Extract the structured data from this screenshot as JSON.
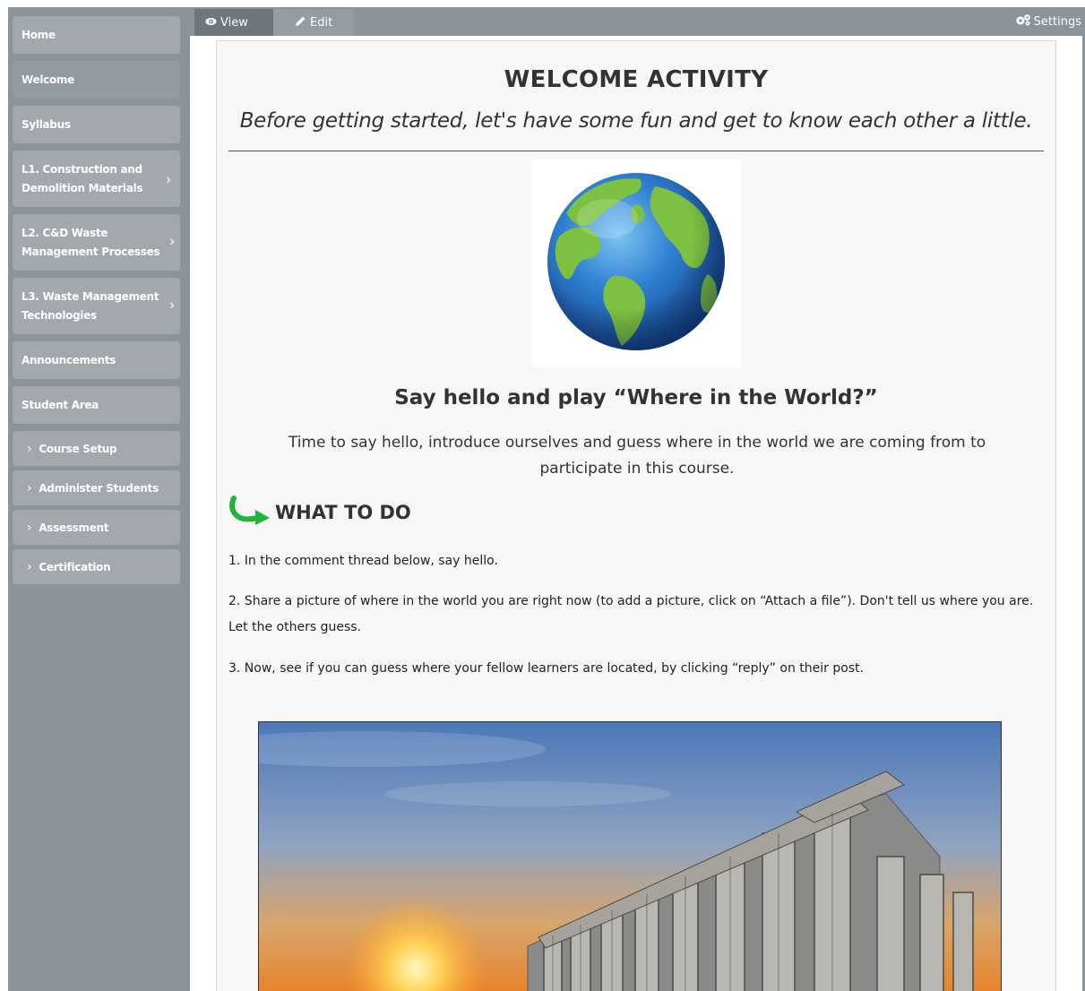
{
  "sidebar": {
    "items": [
      {
        "label": "Home"
      },
      {
        "label": "Welcome"
      },
      {
        "label": "Syllabus"
      },
      {
        "label": "L1. Construction and Demolition Materials"
      },
      {
        "label": "L2. C&D Waste Management Processes"
      },
      {
        "label": "L3. Waste Management Technologies"
      },
      {
        "label": "Announcements"
      },
      {
        "label": "Student Area"
      }
    ],
    "sub_items": [
      {
        "label": "Course Setup"
      },
      {
        "label": "Administer Students"
      },
      {
        "label": "Assessment"
      },
      {
        "label": "Certification"
      }
    ]
  },
  "toolbar": {
    "view_label": "View",
    "edit_label": "Edit",
    "settings_label": "Settings"
  },
  "content": {
    "title": "WELCOME ACTIVITY",
    "subtitle": "Before getting started, let's have some fun and get to know each other a little.",
    "heading": "Say hello and play “Where in the World?”",
    "intro": "Time to say hello, introduce ourselves and guess where in the world we are coming from to participate in this course.",
    "todo_label": "WHAT TO DO",
    "steps": [
      "1.  In the comment thread below, say hello.",
      "2. Share a picture of where in the world you are right now (to add a picture, click on “Attach a file”). Don't tell us where you are. Let the others guess.",
      "3. Now, see if you can guess where your fellow learners are located, by clicking “reply” on their post."
    ]
  },
  "colors": {
    "sidebar_bg": "#8b939b",
    "nav_item_bg": "#a2a8ae",
    "arrow_green": "#22b33a",
    "globe_ocean": "#2b73c9",
    "globe_land": "#7cc142"
  },
  "icons": {
    "view": "eye-icon",
    "edit": "pencil-icon",
    "settings": "gears-icon",
    "todo": "green-curved-arrow-icon"
  }
}
